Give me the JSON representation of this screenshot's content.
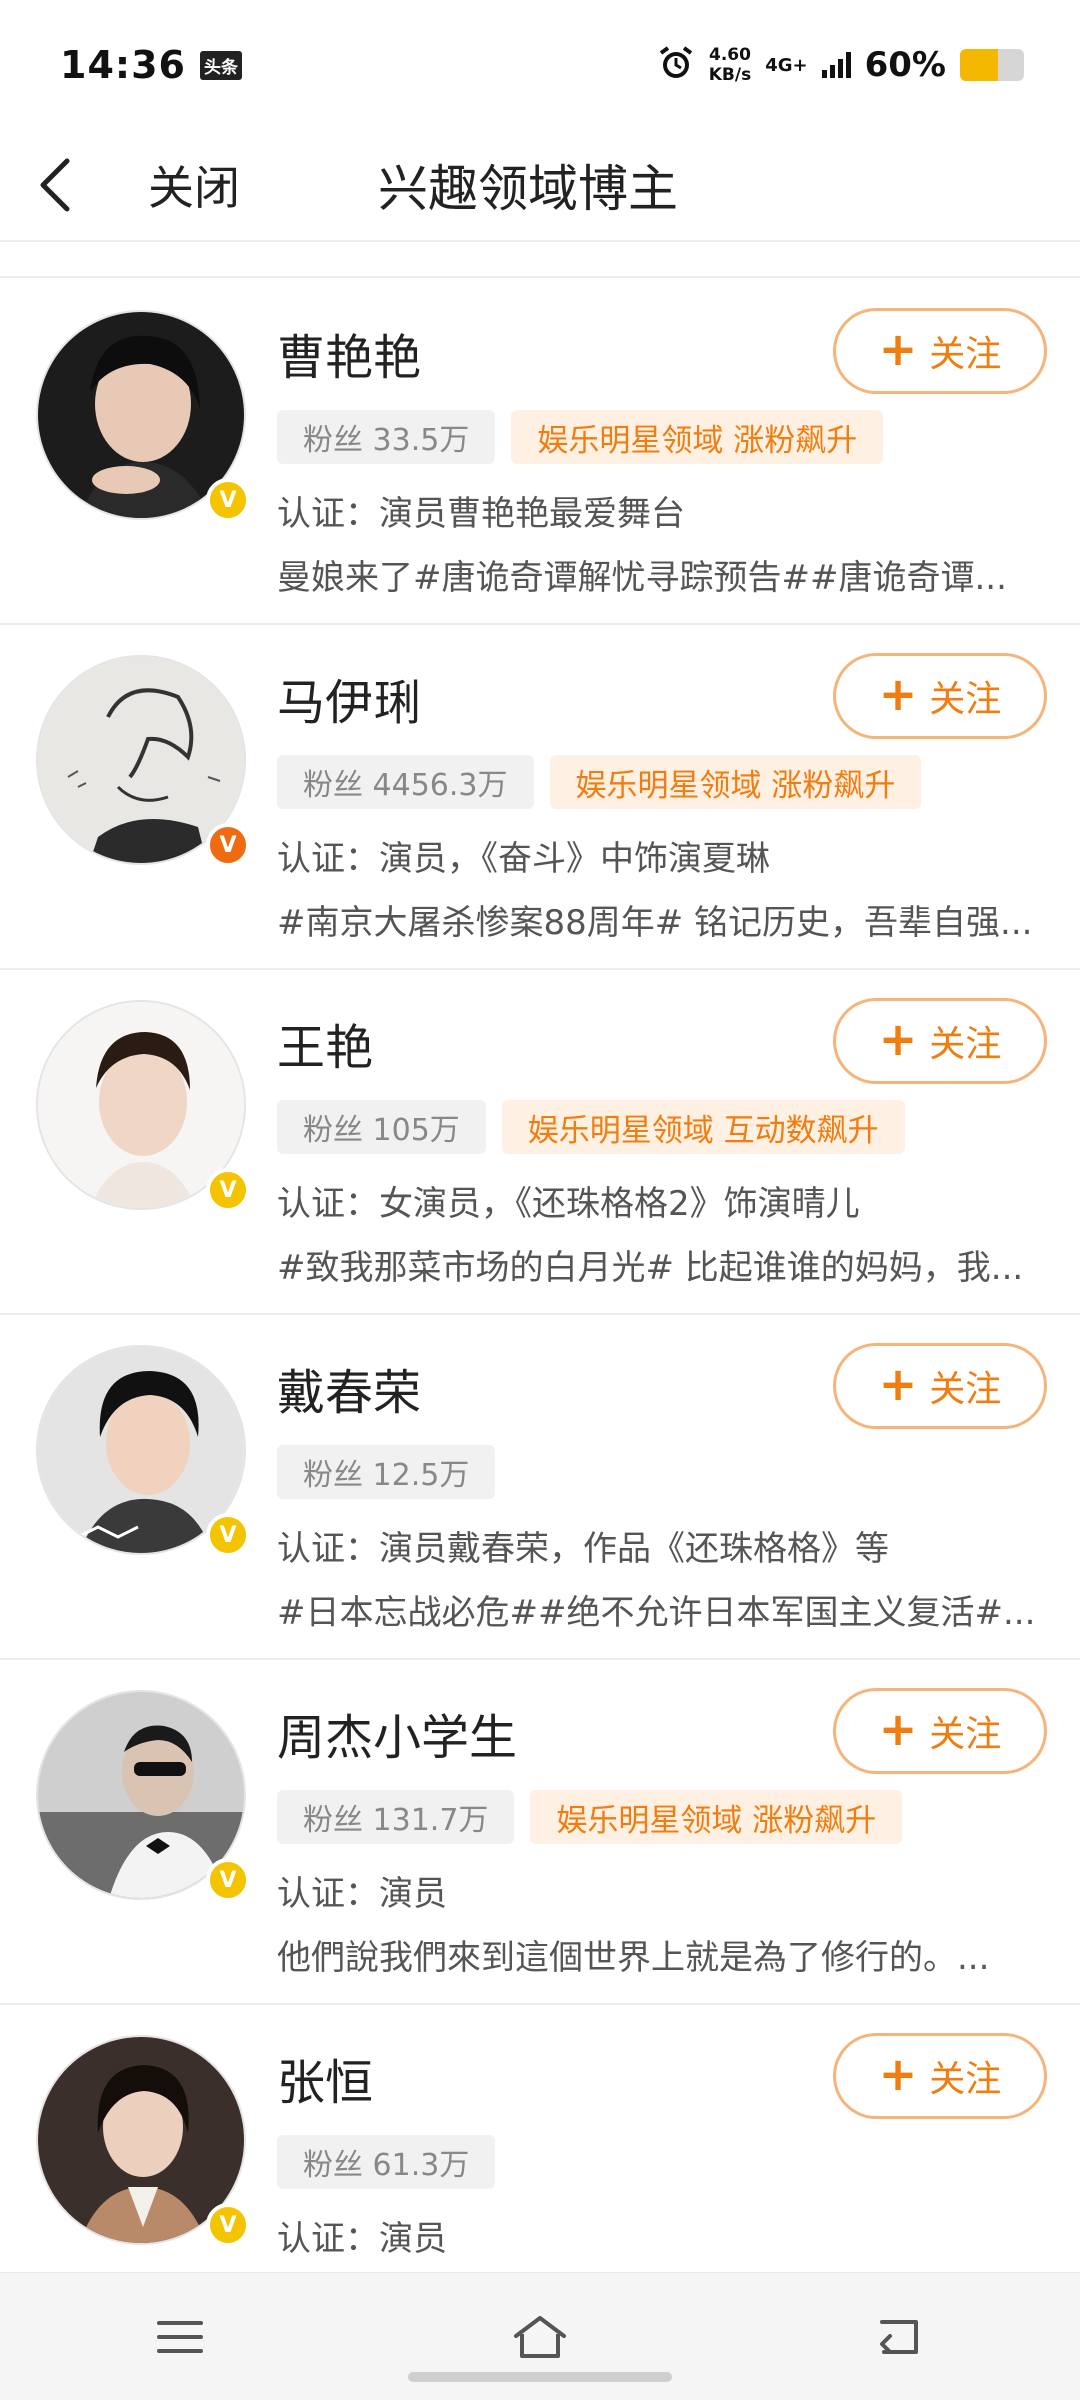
{
  "status_bar": {
    "time": "14:36",
    "app_badge": "头条",
    "net_speed_value": "4.60",
    "net_speed_unit": "KB/s",
    "network": "4G+",
    "battery_percent": "60%",
    "battery_level": 0.6,
    "battery_color": "#f5b800"
  },
  "nav": {
    "back_icon": "chevron-left-icon",
    "close_label": "关闭",
    "title": "兴趣领域博主"
  },
  "follow_label": "关注",
  "cards": [
    {
      "name": "曹艳艳",
      "fans": "粉丝 33.5万",
      "field": "娱乐明星领域 涨粉飙升",
      "verify": "认证：演员曹艳艳最爱舞台",
      "desc": "曼娘来了#唐诡奇谭解忧寻踪预告##唐诡奇谭...",
      "badge": "V",
      "badge_color": "#f5c400"
    },
    {
      "name": "马伊琍",
      "fans": "粉丝 4456.3万",
      "field": "娱乐明星领域 涨粉飙升",
      "verify": "认证：演员，《奋斗》中饰演夏琳",
      "desc": "#南京大屠杀惨案88周年# 铭记历史，吾辈自强...",
      "badge": "V",
      "badge_color": "#f06a0f"
    },
    {
      "name": "王艳",
      "fans": "粉丝 105万",
      "field": "娱乐明星领域 互动数飙升",
      "verify": "认证：女演员，《还珠格格2》饰演晴儿",
      "desc": "#致我那菜市场的白月光# 比起谁谁的妈妈，我...",
      "badge": "V",
      "badge_color": "#f5c400"
    },
    {
      "name": "戴春荣",
      "fans": "粉丝 12.5万",
      "field": "",
      "verify": "认证：演员戴春荣，作品《还珠格格》等",
      "desc": "#日本忘战必危##绝不允许日本军国主义复活#...",
      "badge": "V",
      "badge_color": "#f5c400"
    },
    {
      "name": "周杰小学生",
      "fans": "粉丝 131.7万",
      "field": "娱乐明星领域 涨粉飙升",
      "verify": "认证：演员",
      "desc": "他們說我們來到這個世界上就是為了修行的。...",
      "badge": "V",
      "badge_color": "#f5c400"
    },
    {
      "name": "张恒",
      "fans": "粉丝 61.3万",
      "field": "",
      "verify": "认证：演员",
      "desc": "",
      "badge": "V",
      "badge_color": "#f5c400"
    }
  ],
  "bottom_nav": [
    "menu-icon",
    "home-icon",
    "back-icon"
  ]
}
